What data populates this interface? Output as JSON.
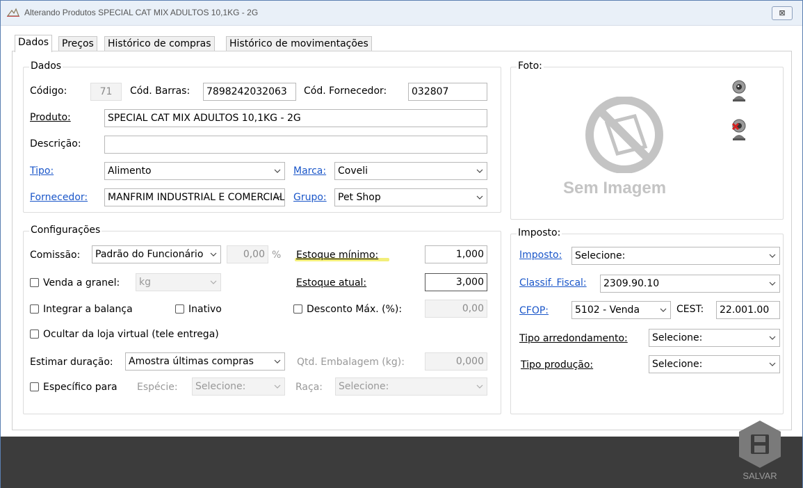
{
  "window": {
    "title": "Alterando Produtos SPECIAL CAT MIX ADULTOS 10,1KG - 2G",
    "close_glyph": "⊠"
  },
  "tabs": [
    "Dados",
    "Preços",
    "Histórico de compras",
    "Histórico de movimentações"
  ],
  "dados": {
    "group_title": "Dados",
    "codigo_label": "Código:",
    "codigo_value": "71",
    "barras_label": "Cód. Barras:",
    "barras_value": "7898242032063",
    "fornecedor_cod_label": "Cód. Fornecedor:",
    "fornecedor_cod_value": "032807",
    "produto_label": "Produto:",
    "produto_value": "SPECIAL CAT MIX ADULTOS 10,1KG - 2G",
    "descricao_label": "Descrição:",
    "descricao_value": "",
    "tipo_label": "Tipo:",
    "tipo_value": "Alimento",
    "marca_label": "Marca:",
    "marca_value": "Coveli",
    "fornecedor_label": "Fornecedor:",
    "fornecedor_value": "MANFRIM INDUSTRIAL E COMERCIAL",
    "grupo_label": "Grupo:",
    "grupo_value": "Pet Shop"
  },
  "foto": {
    "group_title": "Foto:",
    "placeholder_text": "Sem Imagem"
  },
  "config": {
    "group_title": "Configurações",
    "comissao_label": "Comissão:",
    "comissao_value": "Padrão do Funcionário",
    "comissao_pct": "0,00",
    "pct_sign": "%",
    "estoque_min_label": "Estoque mínimo:",
    "estoque_min_value": "1,000",
    "granel_label": "Venda a granel:",
    "granel_unit": "kg",
    "estoque_atual_label": "Estoque atual:",
    "estoque_atual_value": "3,000",
    "balanca_label": "Integrar a balança",
    "inativo_label": "Inativo",
    "desconto_label": "Desconto Máx. (%):",
    "desconto_value": "0,00",
    "ocultar_label": "Ocultar da loja virtual (tele entrega)",
    "estimar_label": "Estimar duração:",
    "estimar_value": "Amostra últimas compras",
    "qtd_emb_label": "Qtd. Embalagem (kg):",
    "qtd_emb_value": "0,000",
    "especifico_label": "Específico para",
    "especie_label": "Espécie:",
    "especie_value": "Selecione:",
    "raca_label": "Raça:",
    "raca_value": "Selecione:"
  },
  "imposto": {
    "group_title": "Imposto:",
    "imposto_label": "Imposto:",
    "imposto_value": "Selecione:",
    "classif_label": "Classif. Fiscal:",
    "classif_value": "2309.90.10",
    "cfop_label": "CFOP:",
    "cfop_value": "5102 - Venda",
    "cest_label": "CEST:",
    "cest_value": "22.001.00",
    "arred_label": "Tipo arredondamento:",
    "arred_value": "Selecione:",
    "producao_label": "Tipo produção:",
    "producao_value": "Selecione:"
  },
  "footer": {
    "save_label": "SALVAR"
  },
  "colors": {
    "link": "#1a56c9",
    "highlight": "#f2ee7a",
    "footer": "#3c3c3c"
  }
}
